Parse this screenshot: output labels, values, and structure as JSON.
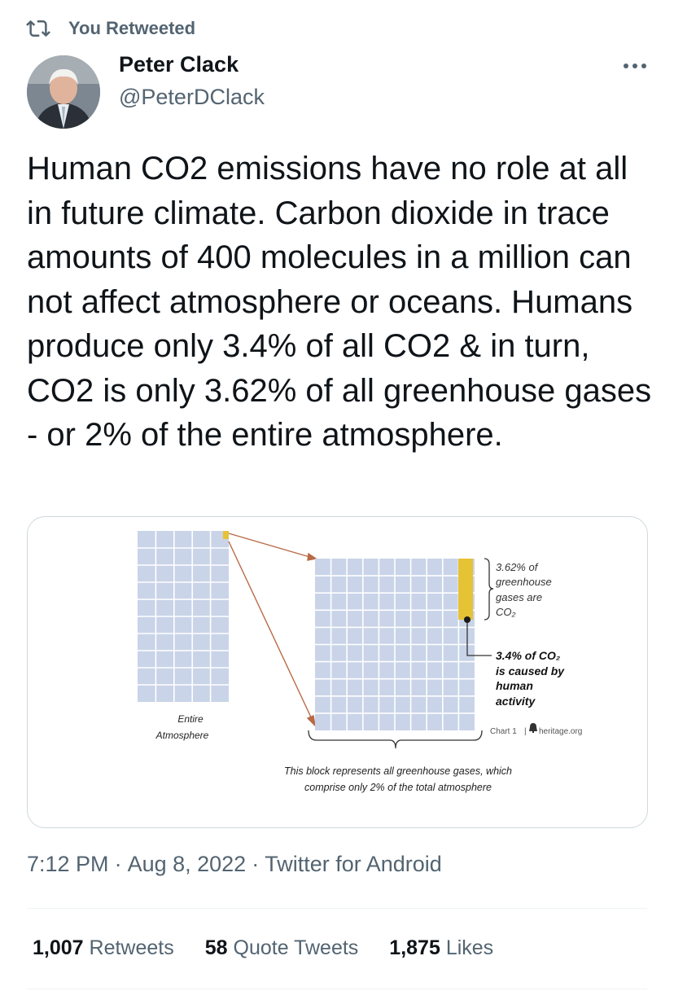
{
  "social_context": {
    "icon": "retweet-icon",
    "label": "You Retweeted"
  },
  "author": {
    "name": "Peter Clack",
    "handle": "@PeterDClack"
  },
  "tweet": {
    "text": "Human CO2 emissions have no role at all in future climate. Carbon dioxide in trace amounts of 400 molecules in a million can not affect atmosphere or oceans. Humans produce only 3.4% of all CO2 & in turn, CO2 is only 3.62% of all greenhouse gases - or 2% of the entire atmosphere."
  },
  "media_image": {
    "left_block_label_line1": "Entire",
    "left_block_label_line2": "Atmosphere",
    "greenhouse_label_lines": [
      "3.62% of",
      "greenhouse",
      "gases are",
      "CO₂"
    ],
    "human_label_lines": [
      "3.4% of CO₂",
      "is caused by",
      "human",
      "activity"
    ],
    "source": "Chart 1",
    "source_site": "heritage.org",
    "caption_line1": "This block represents all greenhouse gases, which",
    "caption_line2": "comprise only 2% of the total atmosphere",
    "colors": {
      "grid_cell": "#c9d4e8",
      "highlight": "#e6c235",
      "arrow": "#b86a45"
    }
  },
  "meta": {
    "time": "7:12 PM",
    "date": "Aug 8, 2022",
    "client": "Twitter for Android",
    "separator": "·"
  },
  "stats": {
    "retweets_count": "1,007",
    "retweets_label": "Retweets",
    "quotes_count": "58",
    "quotes_label": "Quote Tweets",
    "likes_count": "1,875",
    "likes_label": "Likes"
  }
}
